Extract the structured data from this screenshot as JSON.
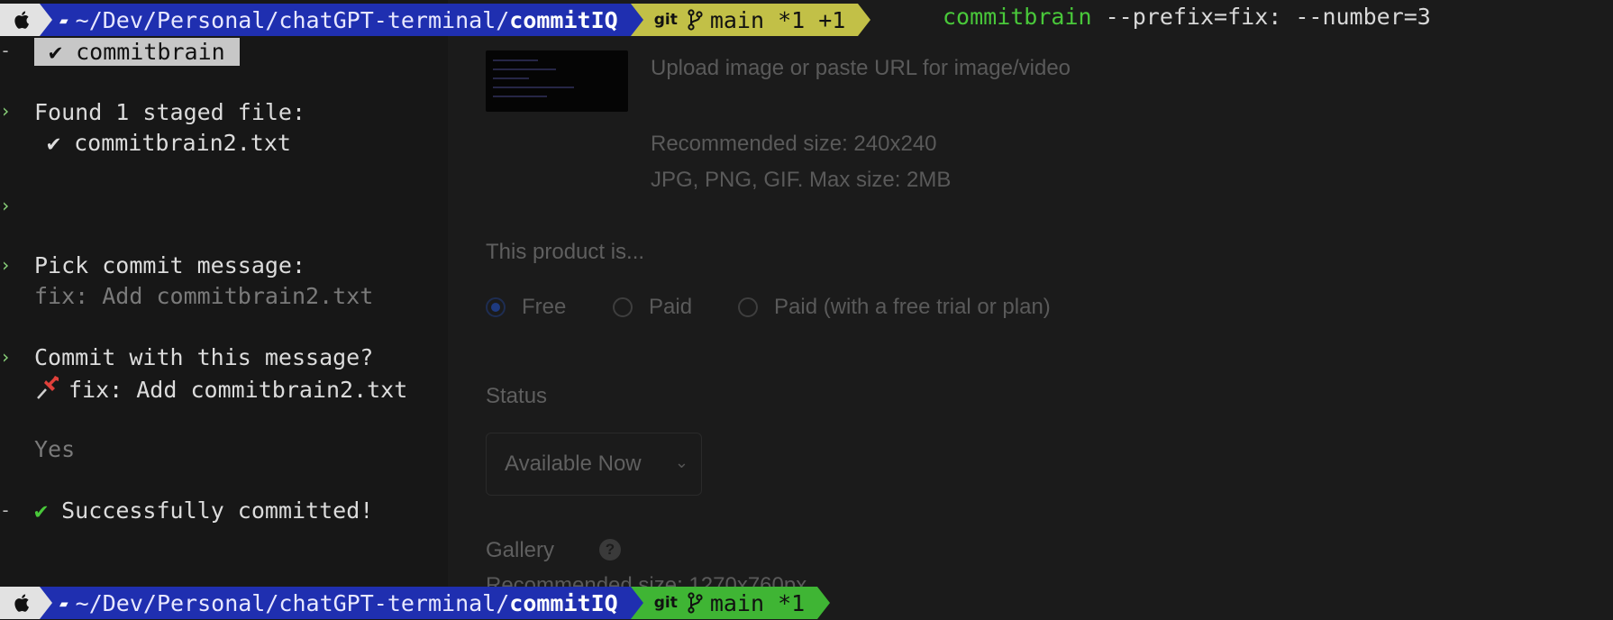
{
  "terminal": {
    "prompt_top": {
      "apple_icon": "apple-icon",
      "folder_icon": "folder-icon",
      "path_prefix": "~/Dev/Personal/chatGPT-terminal/",
      "path_current": "commitIQ",
      "git_label": "git",
      "branch_icon": "git-branch-icon",
      "branch_status": "main *1 +1",
      "command_name": "commitbrain",
      "command_args": " --prefix=fix: --number=3"
    },
    "task_label": "✔ commitbrain",
    "lines": {
      "found": "Found 1 staged file:",
      "file": "✔ commitbrain2.txt",
      "pick": "Pick commit message:",
      "pick_value": "fix: Add commitbrain2.txt",
      "confirm": "Commit with this message?",
      "confirm_value": "fix: Add commitbrain2.txt",
      "answer": "Yes",
      "success_check": "✔",
      "success": "Successfully committed!"
    },
    "prompt_bottom": {
      "path_prefix": "~/Dev/Personal/chatGPT-terminal/",
      "path_current": "commitIQ",
      "git_label": "git",
      "branch_status": "main *1"
    },
    "colors": {
      "path_bg": "#1f2fb0",
      "git_dirty_bg": "#c2c047",
      "git_clean_bg": "#3fb534",
      "command_green": "#49c83a"
    }
  },
  "background_form": {
    "upload_text": "Upload image or paste URL for image/video",
    "recommended_size": "Recommended size: 240x240",
    "formats": "JPG, PNG, GIF. Max size: 2MB",
    "product_label": "This product is...",
    "pricing_options": [
      "Free",
      "Paid",
      "Paid (with a free trial or plan)"
    ],
    "pricing_selected": "Free",
    "status_label": "Status",
    "status_value": "Available Now",
    "gallery_label": "Gallery",
    "gallery_size": "Recommended size: 1270x760px"
  }
}
